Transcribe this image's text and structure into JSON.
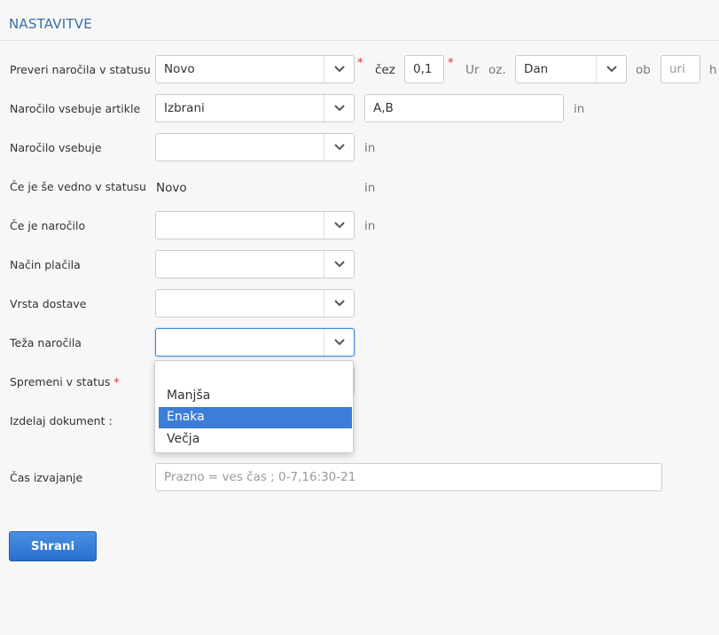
{
  "section": {
    "title": "NASTAVITVE"
  },
  "rows": {
    "status": {
      "label": "Preveri naročila v statusu",
      "value": "Novo",
      "after": "čez",
      "hours_value": "0,1",
      "unit": "Ur",
      "oz": "oz.",
      "day_value": "Dan",
      "ob": "ob",
      "time_placeholder": "uri",
      "h": "h"
    },
    "articles": {
      "label": "Naročilo vsebuje artikle",
      "value": "Izbrani",
      "items": "A,B",
      "in": "in"
    },
    "contains": {
      "label": "Naročilo vsebuje",
      "value": "",
      "in": "in"
    },
    "still_status": {
      "label": "Če je še vedno v statusu",
      "value": "Novo",
      "in": "in"
    },
    "order_is": {
      "label": "Če je naročilo",
      "value": "",
      "in": "in"
    },
    "payment": {
      "label": "Način plačila",
      "value": ""
    },
    "delivery": {
      "label": "Vrsta dostave",
      "value": ""
    },
    "weight": {
      "label": "Teža naročila",
      "value": ""
    },
    "change_status": {
      "label": "Spremeni v status"
    },
    "document": {
      "label": "Izdelaj dokument :"
    },
    "exec_time": {
      "label": "Čas izvajanje",
      "placeholder": "Prazno = ves čas ; 0-7,16:30-21"
    }
  },
  "dropdown": {
    "options": [
      "",
      "Manjša",
      "Enaka",
      "Večja"
    ],
    "highlighted": "Enaka"
  },
  "buttons": {
    "save": "Shrani"
  },
  "colors": {
    "accent": "#3b7dd8",
    "title": "#3a6ea5",
    "required": "#d9302b"
  }
}
